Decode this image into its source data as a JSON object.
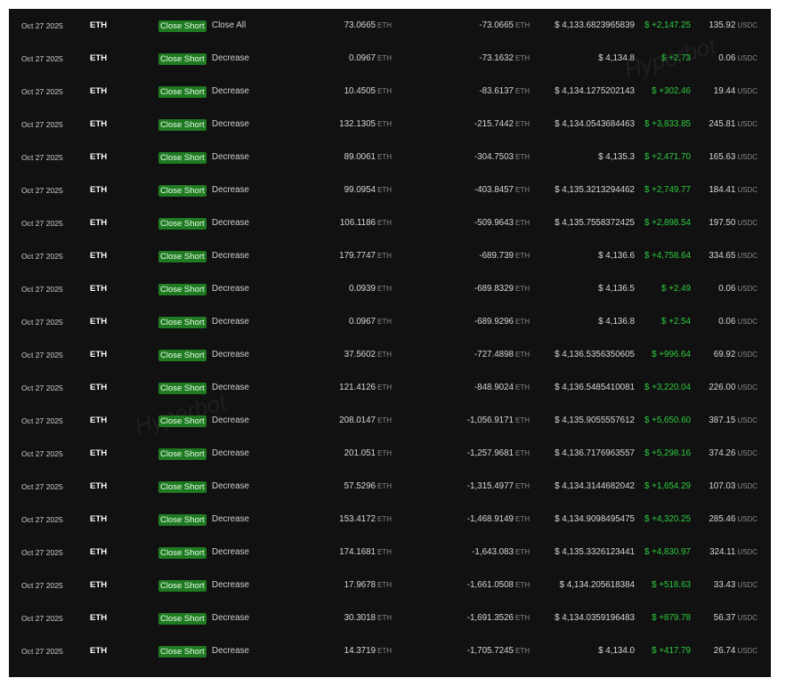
{
  "watermark": "Hyperbot",
  "rows": [
    {
      "date": "Oct 27 2025",
      "symbol": "ETH",
      "type": "Close Short",
      "action": "Close All",
      "size": "73.0665",
      "size_unit": "ETH",
      "position": "-73.0665",
      "position_unit": "ETH",
      "price": "$ 4,133.6823965839",
      "pnl": "$ +2,147.25",
      "fee": "135.92",
      "fee_unit": "USDC"
    },
    {
      "date": "Oct 27 2025",
      "symbol": "ETH",
      "type": "Close Short",
      "action": "Decrease",
      "size": "0.0967",
      "size_unit": "ETH",
      "position": "-73.1632",
      "position_unit": "ETH",
      "price": "$ 4,134.8",
      "pnl": "$ +2.73",
      "fee": "0.06",
      "fee_unit": "USDC"
    },
    {
      "date": "Oct 27 2025",
      "symbol": "ETH",
      "type": "Close Short",
      "action": "Decrease",
      "size": "10.4505",
      "size_unit": "ETH",
      "position": "-83.6137",
      "position_unit": "ETH",
      "price": "$ 4,134.1275202143",
      "pnl": "$ +302.46",
      "fee": "19.44",
      "fee_unit": "USDC"
    },
    {
      "date": "Oct 27 2025",
      "symbol": "ETH",
      "type": "Close Short",
      "action": "Decrease",
      "size": "132.1305",
      "size_unit": "ETH",
      "position": "-215.7442",
      "position_unit": "ETH",
      "price": "$ 4,134.0543684463",
      "pnl": "$ +3,833.85",
      "fee": "245.81",
      "fee_unit": "USDC"
    },
    {
      "date": "Oct 27 2025",
      "symbol": "ETH",
      "type": "Close Short",
      "action": "Decrease",
      "size": "89.0061",
      "size_unit": "ETH",
      "position": "-304.7503",
      "position_unit": "ETH",
      "price": "$ 4,135.3",
      "pnl": "$ +2,471.70",
      "fee": "165.63",
      "fee_unit": "USDC"
    },
    {
      "date": "Oct 27 2025",
      "symbol": "ETH",
      "type": "Close Short",
      "action": "Decrease",
      "size": "99.0954",
      "size_unit": "ETH",
      "position": "-403.8457",
      "position_unit": "ETH",
      "price": "$ 4,135.3213294462",
      "pnl": "$ +2,749.77",
      "fee": "184.41",
      "fee_unit": "USDC"
    },
    {
      "date": "Oct 27 2025",
      "symbol": "ETH",
      "type": "Close Short",
      "action": "Decrease",
      "size": "106.1186",
      "size_unit": "ETH",
      "position": "-509.9643",
      "position_unit": "ETH",
      "price": "$ 4,135.7558372425",
      "pnl": "$ +2,898.54",
      "fee": "197.50",
      "fee_unit": "USDC"
    },
    {
      "date": "Oct 27 2025",
      "symbol": "ETH",
      "type": "Close Short",
      "action": "Decrease",
      "size": "179.7747",
      "size_unit": "ETH",
      "position": "-689.739",
      "position_unit": "ETH",
      "price": "$ 4,136.6",
      "pnl": "$ +4,758.64",
      "fee": "334.65",
      "fee_unit": "USDC"
    },
    {
      "date": "Oct 27 2025",
      "symbol": "ETH",
      "type": "Close Short",
      "action": "Decrease",
      "size": "0.0939",
      "size_unit": "ETH",
      "position": "-689.8329",
      "position_unit": "ETH",
      "price": "$ 4,136.5",
      "pnl": "$ +2.49",
      "fee": "0.06",
      "fee_unit": "USDC"
    },
    {
      "date": "Oct 27 2025",
      "symbol": "ETH",
      "type": "Close Short",
      "action": "Decrease",
      "size": "0.0967",
      "size_unit": "ETH",
      "position": "-689.9296",
      "position_unit": "ETH",
      "price": "$ 4,136.8",
      "pnl": "$ +2.54",
      "fee": "0.06",
      "fee_unit": "USDC"
    },
    {
      "date": "Oct 27 2025",
      "symbol": "ETH",
      "type": "Close Short",
      "action": "Decrease",
      "size": "37.5602",
      "size_unit": "ETH",
      "position": "-727.4898",
      "position_unit": "ETH",
      "price": "$ 4,136.5356350605",
      "pnl": "$ +996.64",
      "fee": "69.92",
      "fee_unit": "USDC"
    },
    {
      "date": "Oct 27 2025",
      "symbol": "ETH",
      "type": "Close Short",
      "action": "Decrease",
      "size": "121.4126",
      "size_unit": "ETH",
      "position": "-848.9024",
      "position_unit": "ETH",
      "price": "$ 4,136.5485410081",
      "pnl": "$ +3,220.04",
      "fee": "226.00",
      "fee_unit": "USDC"
    },
    {
      "date": "Oct 27 2025",
      "symbol": "ETH",
      "type": "Close Short",
      "action": "Decrease",
      "size": "208.0147",
      "size_unit": "ETH",
      "position": "-1,056.9171",
      "position_unit": "ETH",
      "price": "$ 4,135.9055557612",
      "pnl": "$ +5,650.60",
      "fee": "387.15",
      "fee_unit": "USDC"
    },
    {
      "date": "Oct 27 2025",
      "symbol": "ETH",
      "type": "Close Short",
      "action": "Decrease",
      "size": "201.051",
      "size_unit": "ETH",
      "position": "-1,257.9681",
      "position_unit": "ETH",
      "price": "$ 4,136.7176963557",
      "pnl": "$ +5,298.16",
      "fee": "374.26",
      "fee_unit": "USDC"
    },
    {
      "date": "Oct 27 2025",
      "symbol": "ETH",
      "type": "Close Short",
      "action": "Decrease",
      "size": "57.5296",
      "size_unit": "ETH",
      "position": "-1,315.4977",
      "position_unit": "ETH",
      "price": "$ 4,134.3144682042",
      "pnl": "$ +1,654.29",
      "fee": "107.03",
      "fee_unit": "USDC"
    },
    {
      "date": "Oct 27 2025",
      "symbol": "ETH",
      "type": "Close Short",
      "action": "Decrease",
      "size": "153.4172",
      "size_unit": "ETH",
      "position": "-1,468.9149",
      "position_unit": "ETH",
      "price": "$ 4,134.9098495475",
      "pnl": "$ +4,320.25",
      "fee": "285.46",
      "fee_unit": "USDC"
    },
    {
      "date": "Oct 27 2025",
      "symbol": "ETH",
      "type": "Close Short",
      "action": "Decrease",
      "size": "174.1681",
      "size_unit": "ETH",
      "position": "-1,643.083",
      "position_unit": "ETH",
      "price": "$ 4,135.3326123441",
      "pnl": "$ +4,830.97",
      "fee": "324.11",
      "fee_unit": "USDC"
    },
    {
      "date": "Oct 27 2025",
      "symbol": "ETH",
      "type": "Close Short",
      "action": "Decrease",
      "size": "17.9678",
      "size_unit": "ETH",
      "position": "-1,661.0508",
      "position_unit": "ETH",
      "price": "$ 4,134.205618384",
      "pnl": "$ +518.63",
      "fee": "33.43",
      "fee_unit": "USDC"
    },
    {
      "date": "Oct 27 2025",
      "symbol": "ETH",
      "type": "Close Short",
      "action": "Decrease",
      "size": "30.3018",
      "size_unit": "ETH",
      "position": "-1,691.3526",
      "position_unit": "ETH",
      "price": "$ 4,134.0359196483",
      "pnl": "$ +879.78",
      "fee": "56.37",
      "fee_unit": "USDC"
    },
    {
      "date": "Oct 27 2025",
      "symbol": "ETH",
      "type": "Close Short",
      "action": "Decrease",
      "size": "14.3719",
      "size_unit": "ETH",
      "position": "-1,705.7245",
      "position_unit": "ETH",
      "price": "$ 4,134.0",
      "pnl": "$ +417.79",
      "fee": "26.74",
      "fee_unit": "USDC"
    }
  ]
}
